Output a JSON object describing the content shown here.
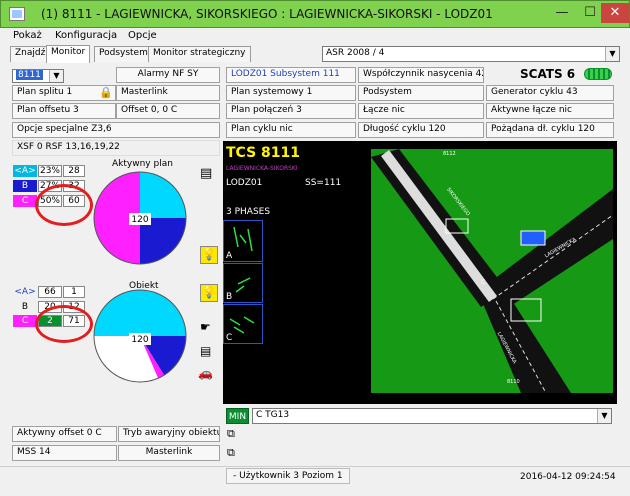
{
  "window": {
    "title": "(1)  8111 - LAGIEWNICKA, SIKORSKIEGO : LAGIEWNICKA-SIKORSKI - LODZ01",
    "min_btn": "—",
    "max_btn": "☐",
    "close_btn": "✕"
  },
  "menu": [
    "Pokaż",
    "Konfiguracja",
    "Opcje"
  ],
  "tabs": [
    "Znajdź",
    "Monitor",
    "Podsystem",
    "Monitor strategiczny"
  ],
  "asr_combo": "ASR 2008 / 4",
  "left": {
    "site_combo": "8111",
    "alarms": "Alarmy  NF SY",
    "plan_split": "Plan splitu 1",
    "masterlink": "Masterlink",
    "plan_offset": "Plan offsetu 3",
    "offset": "Offset  0, 0 C",
    "special": "Opcje specjalne  Z3,6",
    "xsf": "XSF 0 RSF 13,16,19,22",
    "active_plan": "Aktywny plan",
    "object": "Obiekt",
    "plan_table": [
      [
        "<A>",
        "23%",
        "28"
      ],
      [
        "B",
        "27%",
        "32"
      ],
      [
        "C",
        "50%",
        "60"
      ]
    ],
    "obj_table": [
      [
        "<A>",
        "66",
        "1"
      ],
      [
        "B",
        "20",
        "12"
      ],
      [
        "C",
        "2",
        "71"
      ]
    ],
    "pie_center": "120",
    "obj_center": "120",
    "active_offset": "Aktywny offset 0 C",
    "emergency": "Tryb awaryjny obiektu",
    "mss": "MSS  14",
    "masterlink2": "Masterlink"
  },
  "subsystem": {
    "lodz_subsystem": "LODZ01 Subsystem 111",
    "saturation": "Współczynnik nasycenia 42",
    "scats": "SCATS 6",
    "system_plan": "Plan systemowy 1",
    "podsystem": "Podsystem",
    "cycle_gen": "Generator cyklu 43",
    "link_plan": "Plan połączeń 3",
    "link": "Łącze  nic",
    "active_link": "Aktywne łącze nic",
    "cycle_plan": "Plan cyklu  nic",
    "cycle_length": "Długość cyklu 120",
    "desired_cycle": "Pożądana dł. cyklu 120"
  },
  "panel": {
    "tcs": "TCS 8111",
    "sub": "LAGIEWNICKA-SIKORSKI",
    "lodz": "LODZ01",
    "ss": "SS=111",
    "phases": "3 PHASES",
    "phase_labels": [
      "A",
      "B",
      "C"
    ],
    "map_labels": [
      "8112",
      "SIKORSKIEGO",
      "LAGIEWNICKA",
      "LAGIEWNICKA",
      "8110",
      "C"
    ]
  },
  "bottom": {
    "min": "MIN",
    "tg": "C  TG13"
  },
  "status": {
    "user": "- Użytkownik 3 Poziom 1",
    "datetime": "2016-04-12  09:24:54"
  },
  "colors": {
    "A": "#00d8ff",
    "B": "#1a1ad0",
    "C": "#ff20ff",
    "title_green": "#7fd14e"
  }
}
